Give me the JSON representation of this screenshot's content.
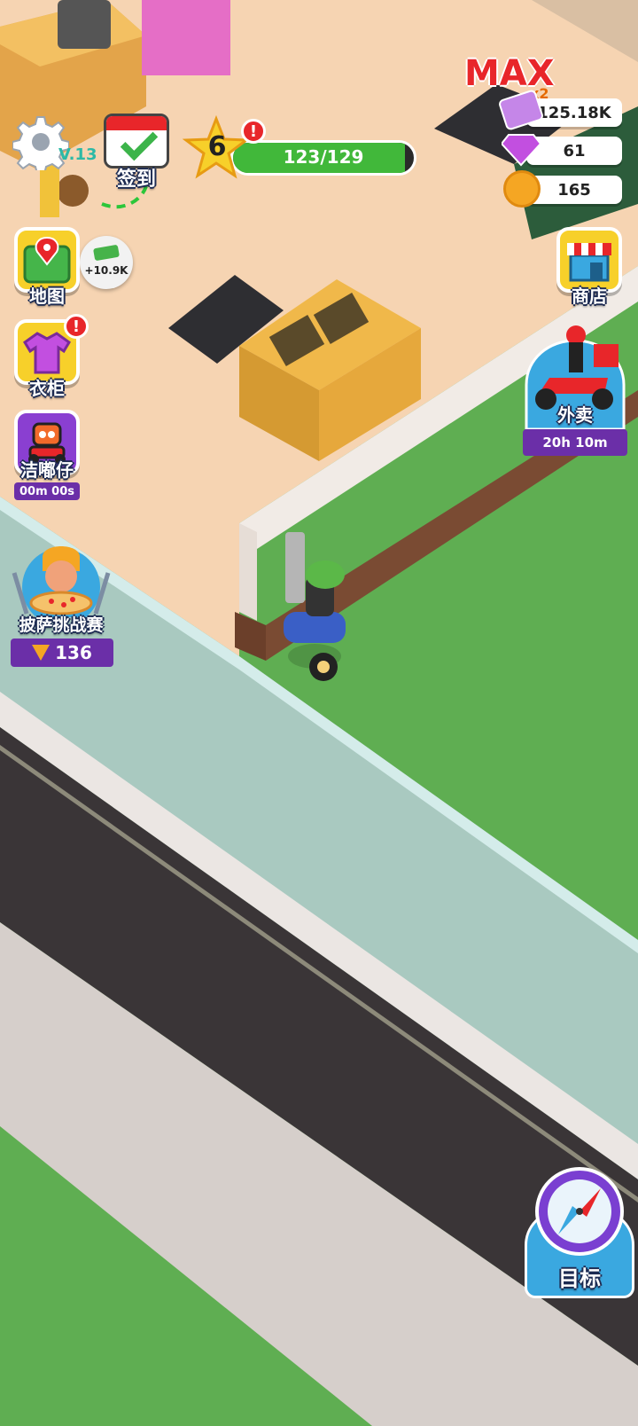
{
  "hud": {
    "version": "V.13",
    "checkin_label": "签到",
    "level": "6",
    "level_badge": "!",
    "xp_text": "123/129",
    "xp_progress": 0.953,
    "max_label": "MAX",
    "multiplier": "x2",
    "cash": "125.18K",
    "gems": "61",
    "pizza_coins": "165",
    "income_bubble": "+10.9K"
  },
  "left_menu": {
    "map_label": "地图",
    "wardrobe_label": "衣柜",
    "wardrobe_badge": "!",
    "robot_label": "洁嘟仔",
    "robot_timer": "00m 00s",
    "challenge_label": "披萨挑战赛",
    "challenge_count": "136"
  },
  "right_menu": {
    "shop_label": "商店",
    "delivery_label": "外卖",
    "delivery_timer": "20h 10m",
    "goal_label": "目标"
  },
  "colors": {
    "floor": "#f6d4b2",
    "grass": "#5fae52",
    "road": "#3a3537",
    "sidewalk": "#a9c9c0",
    "accent_yellow": "#f7d02a",
    "xp_green": "#41b83a",
    "purple": "#6b2fa8",
    "badge_red": "#e8262a",
    "button_blue": "#3aa8e0"
  }
}
